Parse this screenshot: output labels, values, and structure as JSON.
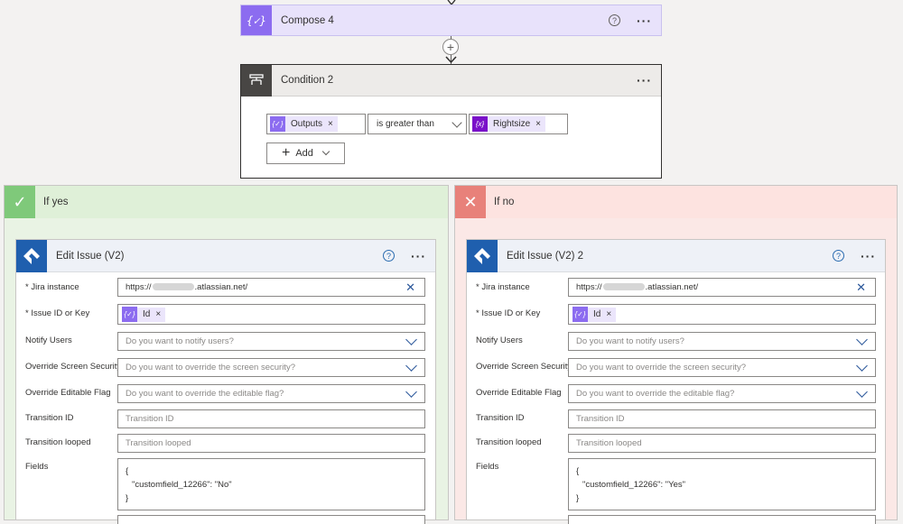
{
  "compose": {
    "title": "Compose 4",
    "icon": "expression-icon",
    "help": "?",
    "more": "···"
  },
  "condition": {
    "title": "Condition 2",
    "more": "···",
    "left_token": "Outputs",
    "operator": "is greater than",
    "right_token": "Rightsize",
    "remove": "×",
    "add_label": "Add"
  },
  "branches": {
    "yes": {
      "label": "If yes",
      "card": {
        "title": "Edit Issue (V2)",
        "help": "?",
        "more": "···",
        "jira_label": "* Jira instance",
        "jira_prefix": "https://",
        "jira_suffix": ".atlassian.net/",
        "issue_label": "* Issue ID or Key",
        "issue_token": "Id",
        "notify_label": "Notify Users",
        "notify_ph": "Do you want to notify users?",
        "screen_label": "Override Screen Security",
        "screen_ph": "Do you want to override the screen security?",
        "editable_label": "Override Editable Flag",
        "editable_ph": "Do you want to override the editable flag?",
        "transition_label": "Transition ID",
        "transition_ph": "Transition ID",
        "looped_label": "Transition looped",
        "looped_ph": "Transition looped",
        "fields_label": "Fields",
        "fields_open": "{",
        "fields_line": "\"customfield_12266\": \"No\"",
        "fields_close": "}"
      }
    },
    "no": {
      "label": "If no",
      "card": {
        "title": "Edit Issue (V2) 2",
        "help": "?",
        "more": "···",
        "jira_label": "* Jira instance",
        "jira_prefix": "https://",
        "jira_suffix": ".atlassian.net/",
        "issue_label": "* Issue ID or Key",
        "issue_token": "Id",
        "notify_label": "Notify Users",
        "notify_ph": "Do you want to notify users?",
        "screen_label": "Override Screen Security",
        "screen_ph": "Do you want to override the screen security?",
        "editable_label": "Override Editable Flag",
        "editable_ph": "Do you want to override the editable flag?",
        "transition_label": "Transition ID",
        "transition_ph": "Transition ID",
        "looped_label": "Transition looped",
        "looped_ph": "Transition looped",
        "fields_label": "Fields",
        "fields_open": "{",
        "fields_line": "\"customfield_12266\": \"Yes\"",
        "fields_close": "}"
      }
    }
  },
  "colors": {
    "compose_accent": "#8c6cf0",
    "rightsize_token": "#7a12c9",
    "yes_branch": "#7fc97a",
    "no_branch": "#e8817a",
    "jira_blue": "#1f5fae"
  }
}
